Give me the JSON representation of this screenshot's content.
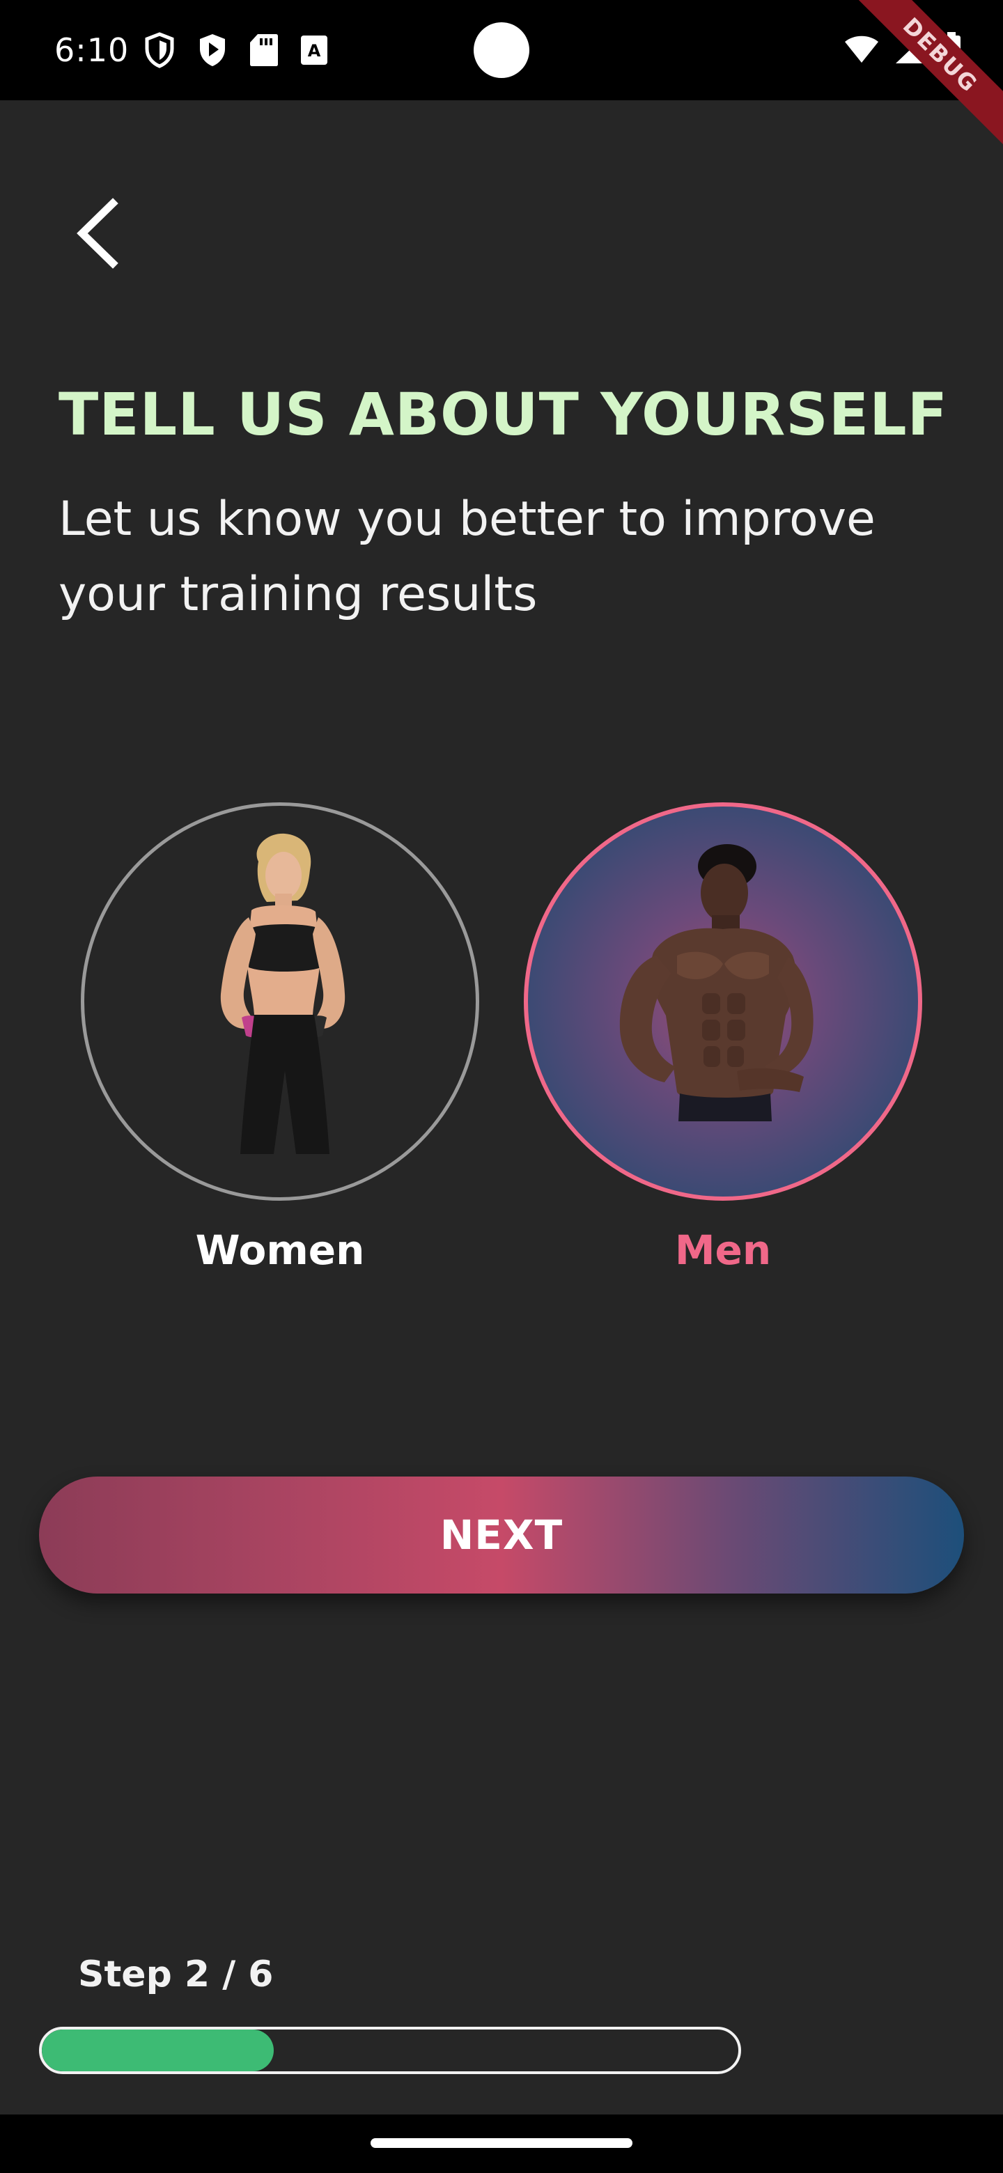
{
  "status_bar": {
    "time": "6:10",
    "icons_left": [
      "shield-icon",
      "play-store-icon",
      "sd-card-icon",
      "font-badge-icon"
    ],
    "icons_right": [
      "wifi-icon",
      "cellular-signal-icon",
      "battery-icon"
    ],
    "debug_label": "DEBUG"
  },
  "header": {
    "back_icon": "chevron-left-icon",
    "title": "TELL US ABOUT YOURSELF",
    "subtitle": "Let us know you better to improve your training results"
  },
  "gender": {
    "options": [
      {
        "label": "Women",
        "selected": false
      },
      {
        "label": "Men",
        "selected": true
      }
    ]
  },
  "actions": {
    "next_label": "NEXT"
  },
  "progress": {
    "step_label": "Step 2 / 6",
    "current": 2,
    "total": 6,
    "fill_fraction": 0.333
  },
  "colors": {
    "background": "#262626",
    "title": "#d4f5c8",
    "accent": "#f06889",
    "progress": "#3dbb74"
  }
}
